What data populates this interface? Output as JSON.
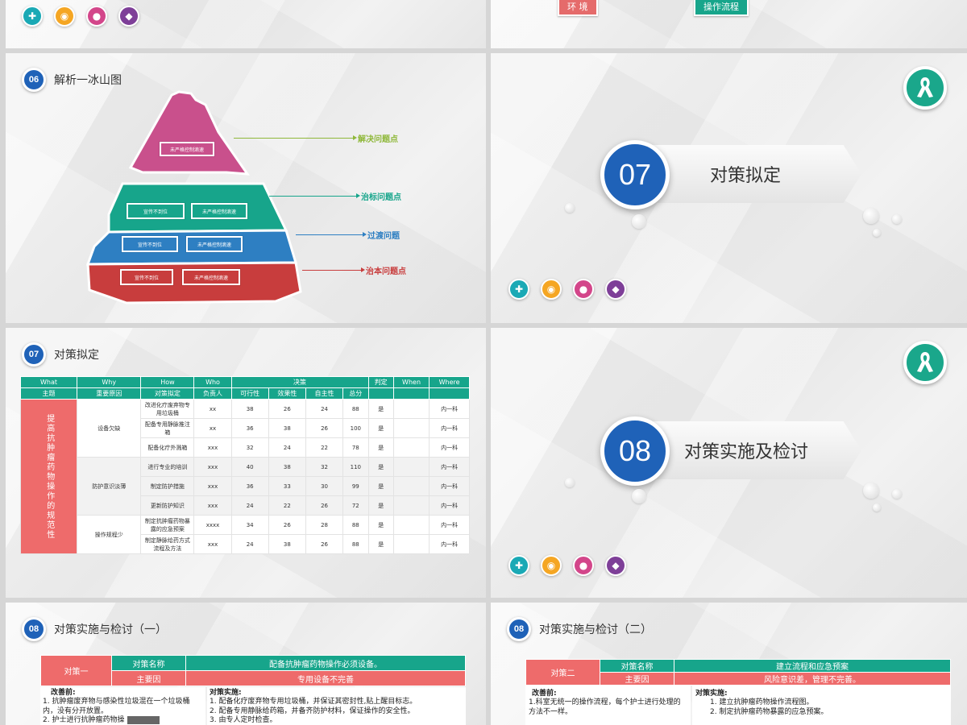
{
  "slide_top_left": {
    "icons": [
      "ambulance-icon",
      "camera-icon",
      "user-icon",
      "pill-icon"
    ]
  },
  "slide_top_right": {
    "btn_left": "环 境",
    "btn_right": "操作流程"
  },
  "slide_iceberg": {
    "badge": "06",
    "title": "解析一冰山图",
    "labels": {
      "solve": "解决问题点",
      "symptom": "治标问题点",
      "transition": "过渡问题",
      "root": "治本问题点"
    },
    "top_box": "未严格控制滴速",
    "rows": [
      {
        "left": "宣传不到位",
        "right": "未严格控制滴速"
      },
      {
        "left": "宣传不到位",
        "right": "未严格控制滴速"
      },
      {
        "left": "宣传不到位",
        "right": "未严格控制滴速"
      }
    ],
    "colors": {
      "pink": "#c9508c",
      "teal": "#17a58b",
      "blue": "#2e7fc2",
      "red": "#c83d3d"
    }
  },
  "slide_07": {
    "number": "07",
    "title": "对策拟定",
    "icons": [
      "ambulance-icon",
      "camera-icon",
      "user-icon",
      "pill-icon"
    ]
  },
  "slide_table": {
    "badge": "07",
    "title": "对策拟定",
    "head1": [
      "What",
      "Why",
      "How",
      "Who",
      "决策",
      "判定",
      "When",
      "Where"
    ],
    "head2": [
      "主题",
      "重要原因",
      "对策拟定",
      "负责人",
      "可行性",
      "效果性",
      "自主性",
      "总分"
    ],
    "main_theme": "提高抗肿瘤药物操作的规范性",
    "groups": [
      {
        "reason": "设备欠缺",
        "rows": [
          [
            "改进化疗废弃物专用垃圾桶",
            "xx",
            "38",
            "26",
            "24",
            "88",
            "是",
            "",
            "内一科"
          ],
          [
            "配备专用静脉推注箱",
            "xx",
            "36",
            "38",
            "26",
            "100",
            "是",
            "",
            "内一科"
          ],
          [
            "配备化疗外溅箱",
            "xxx",
            "32",
            "24",
            "22",
            "78",
            "是",
            "",
            "内一科"
          ]
        ]
      },
      {
        "reason": "防护意识淡薄",
        "rows": [
          [
            "进行专业的培训",
            "xxx",
            "40",
            "38",
            "32",
            "110",
            "是",
            "",
            "内一科"
          ],
          [
            "制定防护措施",
            "xxx",
            "36",
            "33",
            "30",
            "99",
            "是",
            "",
            "内一科"
          ],
          [
            "更新防护知识",
            "xxx",
            "24",
            "22",
            "26",
            "72",
            "是",
            "",
            "内一科"
          ]
        ]
      },
      {
        "reason": "操作规程少",
        "rows": [
          [
            "制定抗肿瘤药物暴露的应急预案",
            "xxxx",
            "34",
            "26",
            "28",
            "88",
            "是",
            "",
            "内一科"
          ],
          [
            "制定静脉给药方式流程及方法",
            "xxx",
            "24",
            "38",
            "26",
            "88",
            "是",
            "",
            "内一科"
          ]
        ]
      }
    ]
  },
  "slide_08": {
    "number": "08",
    "title": "对策实施及检讨",
    "icons": [
      "ambulance-icon",
      "camera-icon",
      "user-icon",
      "pill-icon"
    ]
  },
  "slide_impl1": {
    "badge": "08",
    "title": "对策实施与检讨（一）",
    "strategy_label": "对策一",
    "name_label": "对策名称",
    "name_value": "配备抗肿瘤药物操作必须设备。",
    "cause_label": "主要因",
    "cause_value": "专用设备不完善",
    "before_title": "改善前:",
    "before_lines": [
      "1. 抗肿瘤废弃物与感染性垃圾混在一个垃圾桶内，没有分开放置。",
      "2. 护士进行抗肿瘤药物操"
    ],
    "impl_title": "对策实施:",
    "impl_lines": [
      "1. 配备化疗废弃物专用垃圾桶，并保证其密封性,贴上醒目标志。",
      "2. 配备专用静脉给药箱，并备齐防护材料，保证操作的安全性。",
      "3. 由专人定时检查。"
    ]
  },
  "slide_impl2": {
    "badge": "08",
    "title": "对策实施与检讨（二）",
    "strategy_label": "对策二",
    "name_label": "对策名称",
    "name_value": "建立流程和应急预案",
    "cause_label": "主要因",
    "cause_value": "风险意识差，管理不完善。",
    "before_title": "改善前:",
    "before_lines": [
      "1.科室无统一的操作流程，每个护士进行处理的方法不一样。"
    ],
    "impl_title": "对策实施:",
    "impl_lines": [
      "1.  建立抗肿瘤药物操作流程图。",
      "2.  制定抗肿瘤药物暴露的应急预案。"
    ]
  }
}
